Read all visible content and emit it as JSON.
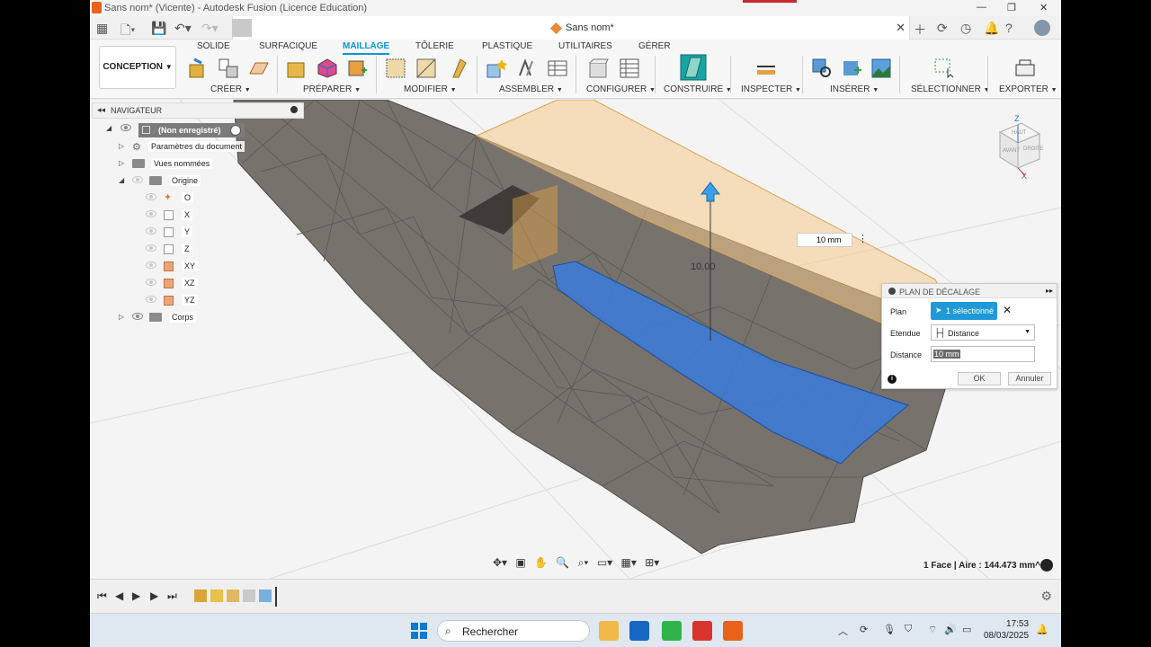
{
  "window": {
    "title": "Sans nom* (Vicente) - Autodesk Fusion (Licence Education)",
    "doc_tab": "Sans nom*"
  },
  "ribbon": {
    "workspace": "CONCEPTION",
    "tabs": [
      "SOLIDE",
      "SURFACIQUE",
      "MAILLAGE",
      "TÔLERIE",
      "PLASTIQUE",
      "UTILITAIRES",
      "GÉRER"
    ],
    "active_tab": "MAILLAGE",
    "groups": [
      "CRÉER",
      "PRÉPARER",
      "MODIFIER",
      "ASSEMBLER",
      "CONFIGURER",
      "CONSTRUIRE",
      "INSPECTER",
      "INSÉRER",
      "SÉLECTIONNER",
      "EXPORTER"
    ]
  },
  "navigator": {
    "title": "NAVIGATEUR",
    "root": "(Non enregistré)",
    "items": [
      {
        "label": "Paramètres du document"
      },
      {
        "label": "Vues nommées"
      },
      {
        "label": "Origine"
      },
      {
        "label": "O"
      },
      {
        "label": "X"
      },
      {
        "label": "Y"
      },
      {
        "label": "Z"
      },
      {
        "label": "XY"
      },
      {
        "label": "XZ"
      },
      {
        "label": "YZ"
      },
      {
        "label": "Corps"
      }
    ]
  },
  "dialog": {
    "title": "PLAN DE DÉCALAGE",
    "plan_label": "Plan",
    "plan_value": "1 sélectionné",
    "etendue_label": "Etendue",
    "etendue_value": "Distance",
    "distance_label": "Distance",
    "distance_value": "10 mm",
    "ok": "OK",
    "cancel": "Annuler"
  },
  "viewport": {
    "float_input": "10 mm",
    "dimension_label": "10.00",
    "status": "1 Face | Aire : 144.473 mm^2",
    "viewcube": {
      "top": "HAUT",
      "front": "AVANT",
      "right": "DROITE",
      "z": "Z",
      "x": "X"
    }
  },
  "taskbar": {
    "search_placeholder": "Rechercher",
    "time": "17:53",
    "date": "08/03/2025"
  },
  "colors": {
    "accent": "#0696d7",
    "selected_face": "#3d7bd6",
    "plane": "#f5c98a"
  }
}
